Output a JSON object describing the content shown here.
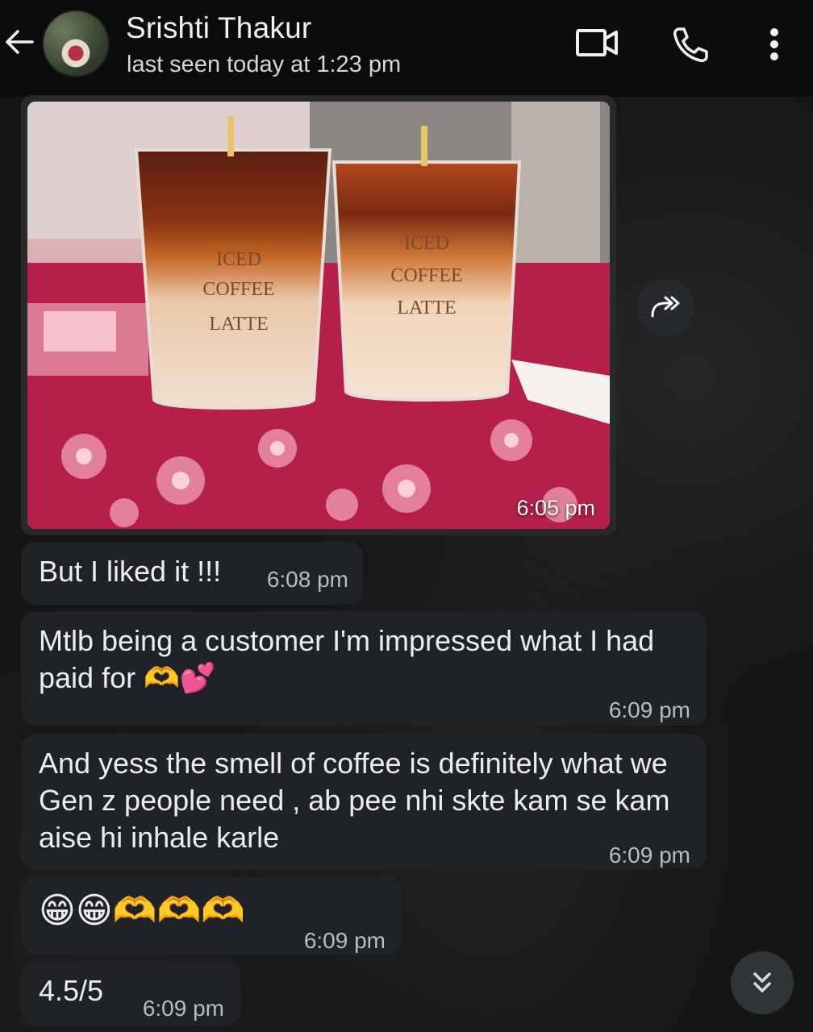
{
  "header": {
    "contact_name": "Srishti Thakur",
    "status": "last seen today at 1:23 pm"
  },
  "photo": {
    "time": "6:05 pm",
    "cup_left": [
      "ICED",
      "COFFEE",
      "LATTE"
    ],
    "cup_right": [
      "ICED",
      "COFFEE",
      "LATTE"
    ]
  },
  "messages": [
    {
      "text": "But I liked it !!!",
      "time": "6:08 pm"
    },
    {
      "text": "Mtlb being a customer I'm impressed what I had paid for 🫶💕",
      "time": "6:09 pm"
    },
    {
      "text": "And yess the smell of coffee is definitely what we Gen z people need , ab pee nhi skte kam se kam aise hi inhale karle",
      "time": "6:09 pm"
    },
    {
      "text": "😁😁🫶🫶🫶",
      "time": "6:09 pm"
    },
    {
      "text": "4.5/5",
      "time": "6:09 pm"
    }
  ],
  "colors": {
    "header_bg": "#0b0b0b",
    "bubble_bg": "#1f2327",
    "chat_bg": "#151515"
  }
}
